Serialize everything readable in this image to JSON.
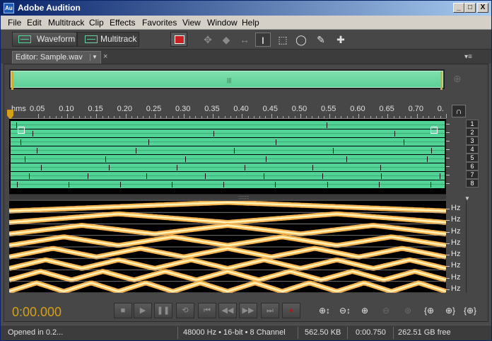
{
  "window": {
    "icon_text": "Au",
    "title": "Adobe Audition",
    "buttons": [
      "_",
      "□",
      "X"
    ]
  },
  "menu": [
    "File",
    "Edit",
    "Multitrack",
    "Clip",
    "Effects",
    "Favorites",
    "View",
    "Window",
    "Help"
  ],
  "toolbar": {
    "waveform_label": "Waveform",
    "multitrack_label": "Multitrack",
    "tool_icons": [
      "move-tool-icon",
      "razor-tool-icon",
      "slip-tool-icon",
      "time-selection-tool-icon",
      "marquee-tool-icon",
      "lasso-tool-icon",
      "brush-tool-icon",
      "spot-healing-tool-icon"
    ]
  },
  "editor": {
    "tab_label": "Editor: Sample.wav",
    "close_glyph": "×",
    "panel_menu_glyph": "▾≡"
  },
  "overview": {
    "handle_glyph": "|||"
  },
  "ruler": {
    "unit": "hms",
    "ticks": [
      "0.05",
      "0.10",
      "0.15",
      "0.20",
      "0.25",
      "0.30",
      "0.35",
      "0.40",
      "0.45",
      "0.50",
      "0.55",
      "0.60",
      "0.65",
      "0.70",
      "0."
    ]
  },
  "channels": [
    "1",
    "2",
    "3",
    "4",
    "5",
    "6",
    "7",
    "8"
  ],
  "spectral": {
    "unit_labels": [
      "Hz",
      "Hz",
      "Hz",
      "Hz",
      "Hz",
      "Hz",
      "Hz",
      "Hz"
    ]
  },
  "transport": {
    "timecode": "0:00.000",
    "buttons": [
      "stop",
      "play",
      "pause",
      "loop",
      "go-to-start",
      "rewind",
      "fast-forward",
      "go-to-end",
      "record"
    ]
  },
  "zoom_buttons": [
    "zoom-in-amplitude",
    "zoom-out-amplitude",
    "zoom-in-time",
    "zoom-out-time",
    "zoom-full",
    "zoom-in-point-in",
    "zoom-in-point-out",
    "zoom-selection"
  ],
  "status": {
    "message": "Opened in 0.2...",
    "format": "48000 Hz • 16-bit • 8 Channel",
    "size": "562.50 KB",
    "duration": "0:00.750",
    "free": "262.51 GB free"
  },
  "colors": {
    "waveform": "#52d396",
    "timecode": "#d4a017",
    "accent_title": "#0a246a"
  }
}
